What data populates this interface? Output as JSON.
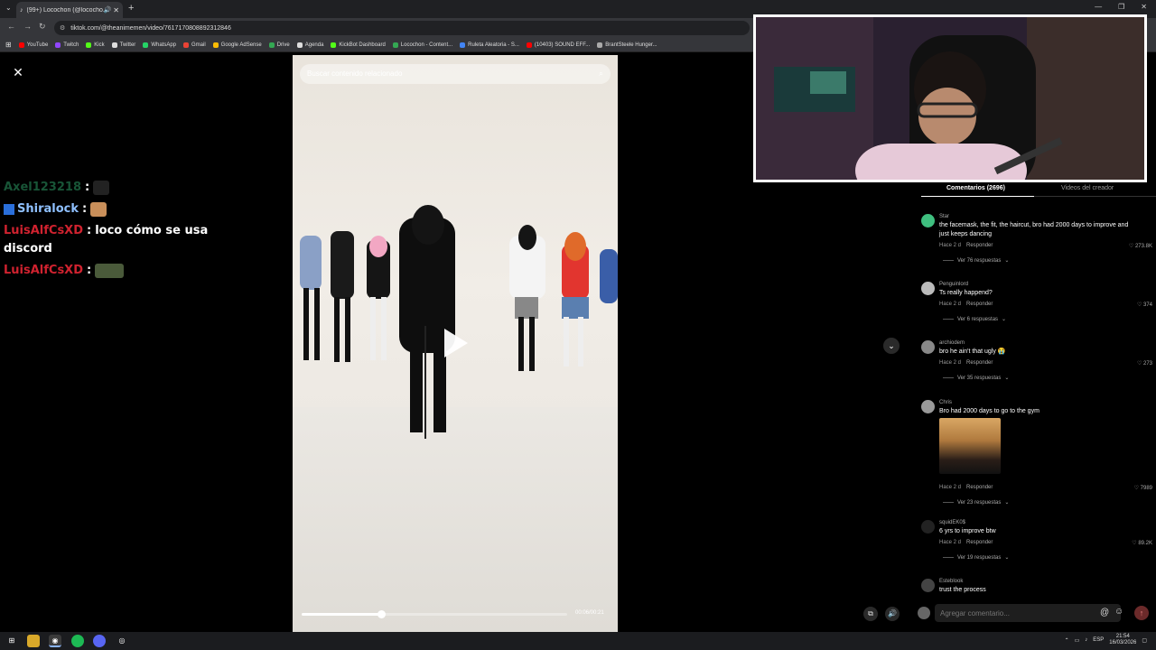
{
  "browser": {
    "tab_title": "(99+) Locochon (@lococho...",
    "url": "tiktok.com/@theanimemen/video/7617170808892312846",
    "new_tab": "+",
    "bookmarks": [
      {
        "label": "YouTube",
        "color": "#ff0000"
      },
      {
        "label": "Twitch",
        "color": "#9146ff"
      },
      {
        "label": "Kick",
        "color": "#53fc18"
      },
      {
        "label": "Twitter",
        "color": "#dddddd"
      },
      {
        "label": "WhatsApp",
        "color": "#25d366"
      },
      {
        "label": "Gmail",
        "color": "#ea4335"
      },
      {
        "label": "Google AdSense",
        "color": "#fbbc04"
      },
      {
        "label": "Drive",
        "color": "#34a853"
      },
      {
        "label": "Agenda",
        "color": "#dddddd"
      },
      {
        "label": "KickBot Dashboard",
        "color": "#53fc18"
      },
      {
        "label": "Locochon - Content...",
        "color": "#34a853"
      },
      {
        "label": "Ruleta Aleatoria - S...",
        "color": "#4285f4"
      },
      {
        "label": "(10403) SOUND EFF...",
        "color": "#ff0000"
      },
      {
        "label": "BrantSteele Hunger...",
        "color": "#aaaaaa"
      }
    ]
  },
  "chat": [
    {
      "user": "Axel123218",
      "color": "#1f6b45",
      "text": "",
      "emote": true
    },
    {
      "user": "Shiralock",
      "color": "#8fc0ff",
      "text": "",
      "emote": true,
      "badges": true
    },
    {
      "user": "LuisAlfCsXD",
      "color": "#d0222f",
      "text": "loco cómo se usa discord",
      "emote": false
    },
    {
      "user": "LuisAlfCsXD",
      "color": "#d0222f",
      "text": "",
      "emote": true
    }
  ],
  "chat_sep": ":",
  "video": {
    "search_placeholder": "Buscar contenido relacionado",
    "timecode": "00:06/00:21",
    "progress_fraction": 0.3
  },
  "comments_panel": {
    "tab_comments": "Comentarios (2696)",
    "tab_creator": "Videos del creador",
    "comments": [
      {
        "user": "Star",
        "text": "the facemask, the fit, the haircut, bro had 2000 days to improve and just keeps dancing",
        "time": "Hace 2 d",
        "reply": "Responder",
        "likes": "273.8K",
        "replies": "Ver 76 respuestas",
        "avatar_color": "#3fbf7f"
      },
      {
        "user": "Penguinlord",
        "text": "Ts really happend?",
        "time": "Hace 2 d",
        "reply": "Responder",
        "likes": "374",
        "replies": "Ver 6 respuestas",
        "avatar_color": "#bbbbbb"
      },
      {
        "user": "archiodem",
        "text": "bro he ain't that ugly 😭",
        "time": "Hace 2 d",
        "reply": "Responder",
        "likes": "273",
        "replies": "Ver 35 respuestas",
        "avatar_color": "#888888"
      },
      {
        "user": "Chris",
        "text": "Bro had 2000 days to go to the gym",
        "time": "Hace 2 d",
        "reply": "Responder",
        "likes": "7989",
        "replies": "Ver 23 respuestas",
        "avatar_color": "#999999"
      },
      {
        "user": "squidEK0$",
        "text": "6 yrs to improve btw",
        "time": "Hace 2 d",
        "reply": "Responder",
        "likes": "89.2K",
        "replies": "Ver 19 respuestas",
        "avatar_color": "#222222"
      },
      {
        "user": "Esteblook",
        "text": "trust the process",
        "avatar_color": "#444444"
      }
    ],
    "input_placeholder": "Agregar comentario...",
    "at_symbol": "@"
  },
  "taskbar": {
    "lang": "ESP",
    "time": "21:54",
    "date": "16/03/2026"
  }
}
